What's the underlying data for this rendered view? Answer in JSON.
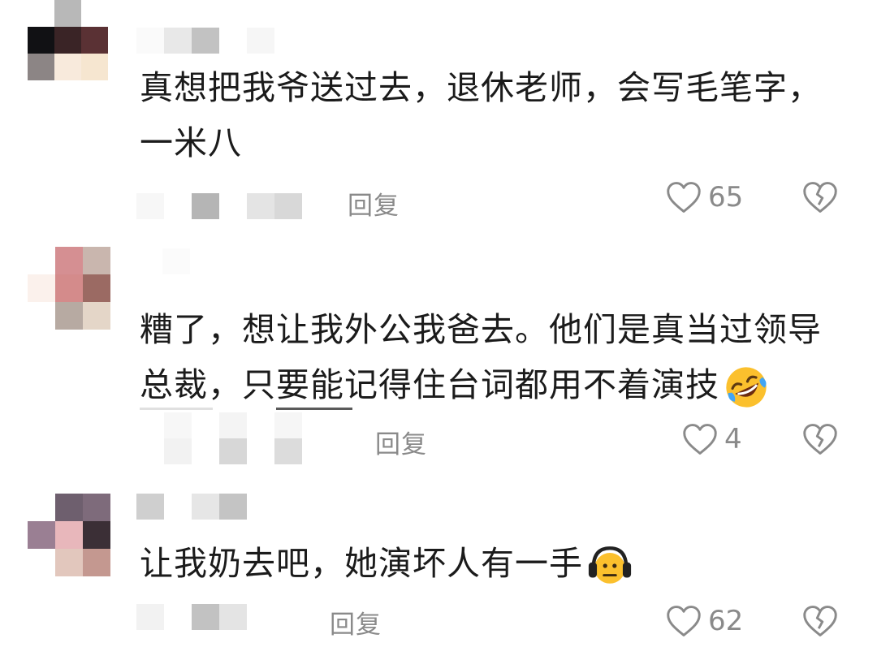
{
  "comments": [
    {
      "text_lines": [
        "真想把我爷送过去，退休老师，会写毛笔字，",
        "一米八"
      ],
      "reply_label": "回复",
      "likes": "65"
    },
    {
      "text_lines": [
        "糟了，想让我外公我爸去。他们是真当过领导",
        "总裁，只要能记得住台词都用不着演技"
      ],
      "reply_label": "回复",
      "likes": "4",
      "emoji": "rolling-on-floor-laughing-emoji"
    },
    {
      "text_lines": [
        "让我奶去吧，她演坏人有一手"
      ],
      "reply_label": "回复",
      "likes": "62",
      "emoji": "headphones-face-emoji"
    }
  ],
  "icons": {
    "like": "heart-outline-icon",
    "dislike": "broken-heart-icon"
  },
  "colors": {
    "text": "#1b1b1b",
    "meta": "#8a8a8a",
    "background": "#ffffff"
  }
}
